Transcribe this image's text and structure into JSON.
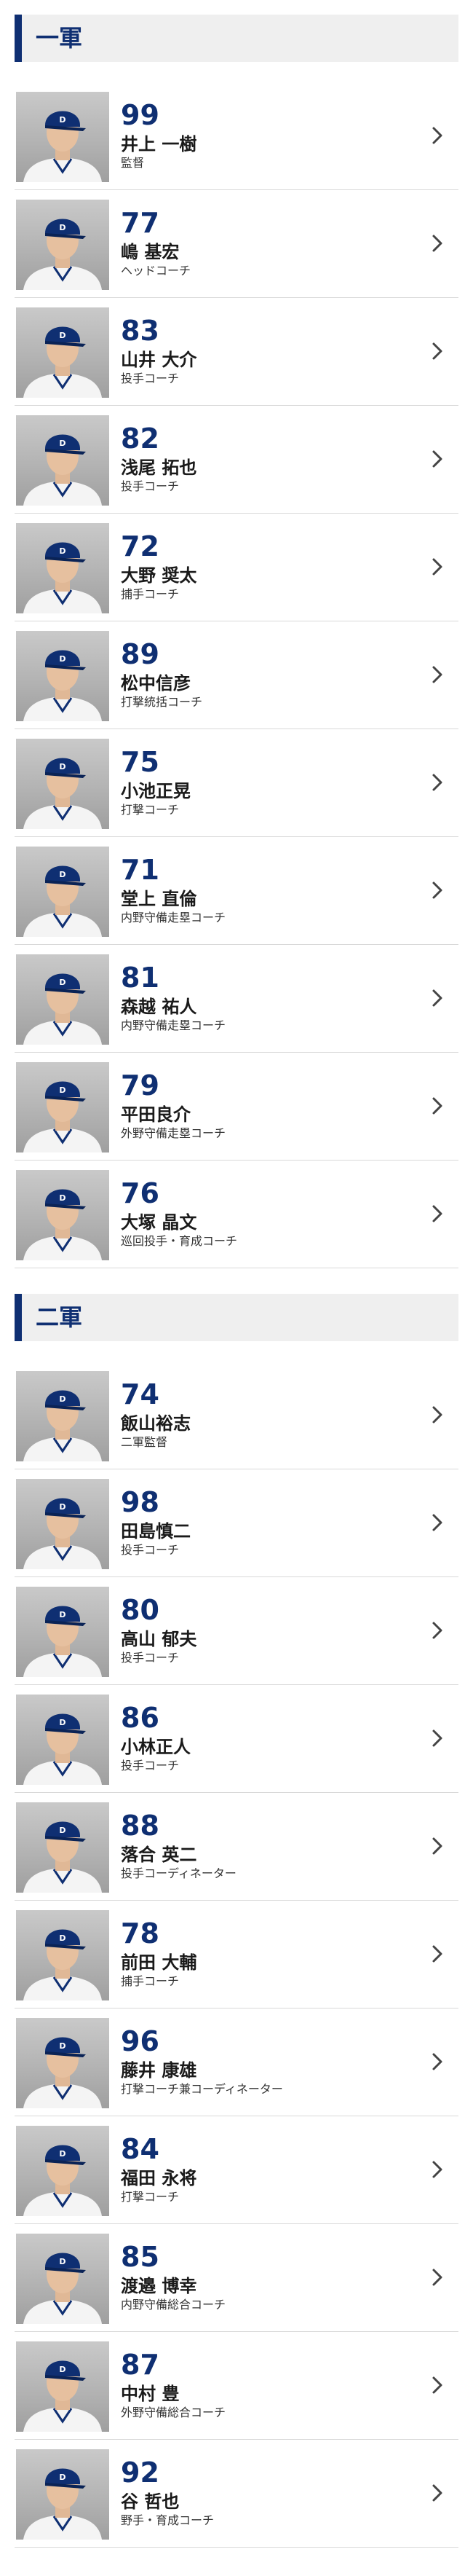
{
  "sections": [
    {
      "title": "一軍",
      "staff": [
        {
          "number": "99",
          "name": "井上 一樹",
          "role": "監督"
        },
        {
          "number": "77",
          "name": "嶋 基宏",
          "role": "ヘッドコーチ"
        },
        {
          "number": "83",
          "name": "山井 大介",
          "role": "投手コーチ"
        },
        {
          "number": "82",
          "name": "浅尾 拓也",
          "role": "投手コーチ"
        },
        {
          "number": "72",
          "name": "大野 奨太",
          "role": "捕手コーチ"
        },
        {
          "number": "89",
          "name": "松中信彦",
          "role": "打撃統括コーチ"
        },
        {
          "number": "75",
          "name": "小池正晃",
          "role": "打撃コーチ"
        },
        {
          "number": "71",
          "name": "堂上 直倫",
          "role": "内野守備走塁コーチ"
        },
        {
          "number": "81",
          "name": "森越 祐人",
          "role": "内野守備走塁コーチ"
        },
        {
          "number": "79",
          "name": "平田良介",
          "role": "外野守備走塁コーチ"
        },
        {
          "number": "76",
          "name": "大塚 晶文",
          "role": "巡回投手・育成コーチ"
        }
      ]
    },
    {
      "title": "二軍",
      "staff": [
        {
          "number": "74",
          "name": "飯山裕志",
          "role": "二軍監督"
        },
        {
          "number": "98",
          "name": "田島慎二",
          "role": "投手コーチ"
        },
        {
          "number": "80",
          "name": "高山 郁夫",
          "role": "投手コーチ"
        },
        {
          "number": "86",
          "name": "小林正人",
          "role": "投手コーチ"
        },
        {
          "number": "88",
          "name": "落合 英二",
          "role": "投手コーディネーター"
        },
        {
          "number": "78",
          "name": "前田 大輔",
          "role": "捕手コーチ"
        },
        {
          "number": "96",
          "name": "藤井 康雄",
          "role": "打撃コーチ兼コーディネーター"
        },
        {
          "number": "84",
          "name": "福田 永将",
          "role": "打撃コーチ"
        },
        {
          "number": "85",
          "name": "渡邉 博幸",
          "role": "内野守備総合コーチ"
        },
        {
          "number": "87",
          "name": "中村 豊",
          "role": "外野守備総合コーチ"
        },
        {
          "number": "92",
          "name": "谷 哲也",
          "role": "野手・育成コーチ"
        }
      ]
    }
  ],
  "icons": {
    "photo": "person-photo-icon",
    "chevron": "chevron-right-icon"
  },
  "colors": {
    "accent": "#0f2f72",
    "header_bg": "#efefef",
    "divider": "#d9d9d9"
  }
}
